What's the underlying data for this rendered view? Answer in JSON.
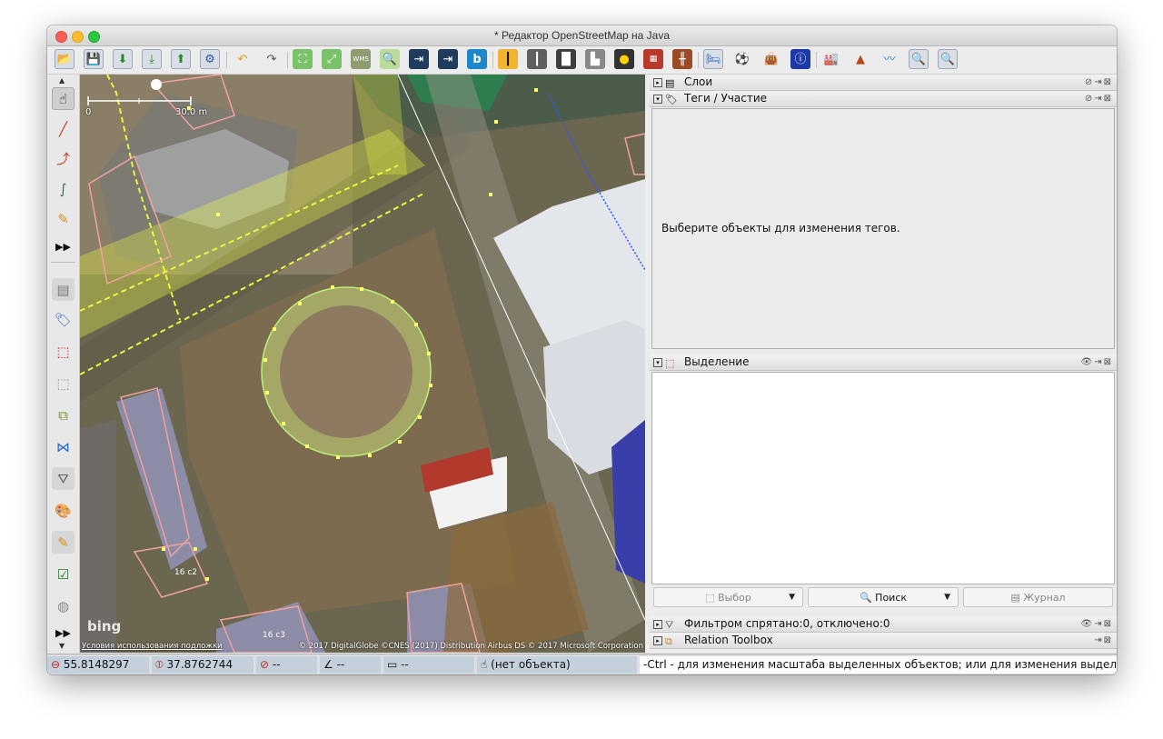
{
  "window": {
    "title": "* Редактор OpenStreetMap на Java"
  },
  "toolbar": {
    "icons": [
      "open-file-icon",
      "save-icon",
      "download-icon",
      "download-area-icon",
      "upload-icon",
      "preferences-icon",
      "undo-icon",
      "redo-icon",
      "zoom-to-data-icon",
      "zoom-selection-icon",
      "wms-icon",
      "zoom-icon",
      "road-preset-icon",
      "road-preset-2-icon",
      "bing-icon",
      "lane-icon",
      "lane-2-icon",
      "barrier-icon",
      "building-icon",
      "traffic-light-icon",
      "wall-icon",
      "railway-icon",
      "accommodation-icon",
      "football-icon",
      "shop-icon",
      "information-icon",
      "industrial-icon",
      "peak-icon",
      "river-icon",
      "search-doc-icon",
      "search-doc-2-icon"
    ]
  },
  "left_tools": [
    "select-tool-icon",
    "draw-tool-icon",
    "improve-way-icon",
    "draw-curve-icon",
    "pencil-icon",
    "more-tools-icon",
    "layers-toggle-icon",
    "tags-toggle-icon",
    "selection-toggle-icon",
    "commands-toggle-icon",
    "conflicts-toggle-icon",
    "validation-toggle-icon",
    "filter-toggle-icon",
    "style-toggle-icon",
    "notes-toggle-icon",
    "checklist-icon",
    "geo-icon",
    "more-toggles-icon"
  ],
  "map": {
    "scale_start": "0",
    "scale_label": "30.0 m",
    "bing_logo": "bing",
    "terms_link": "Условия использования подложки",
    "copyright": "© 2017 DigitalGlobe ©CNES (2017) Distribution Airbus DS © 2017 Microsoft Corporation",
    "building_labels": [
      "16 с2",
      "16 с3"
    ]
  },
  "panels": {
    "layers": {
      "title": "Слои"
    },
    "tags": {
      "title": "Теги / Участие",
      "empty_message": "Выберите объекты для изменения тегов."
    },
    "selection": {
      "title": "Выделение",
      "buttons": {
        "select": "Выбор",
        "search": "Поиск",
        "history": "Журнал"
      }
    },
    "filter": {
      "title": "Фильтром спрятано:0, отключено:0"
    },
    "relation": {
      "title": "Relation Toolbox"
    }
  },
  "status": {
    "lat": "55.8148297",
    "lon": "37.8762744",
    "heading": "--",
    "angle": "--",
    "distance": "--",
    "object": "(нет объекта)",
    "help": "-Ctrl - для изменения масштаба выделенных объектов; или для изменения выделения"
  },
  "colors": {
    "accent": "#2a62c9",
    "status_field": "#c5d0dd",
    "map_highlight": "#e8f542"
  }
}
